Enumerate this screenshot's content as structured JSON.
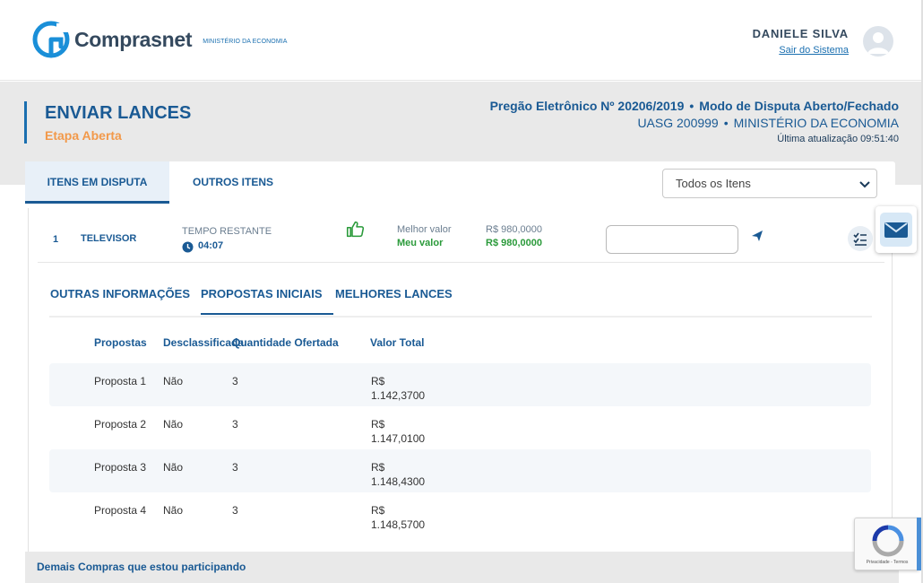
{
  "header": {
    "brand": "Comprasnet",
    "ministry": "MINISTÉRIO DA ECONOMIA",
    "user_name": "DANIELE SILVA",
    "logout": "Sair do Sistema"
  },
  "page": {
    "title": "ENVIAR LANCES",
    "subtitle": "Etapa Aberta",
    "pregao": "Pregão Eletrônico Nº 20206/2019",
    "dot": "•",
    "mode": "Modo de Disputa Aberto/Fechado",
    "uasg": "UASG 200999",
    "ministry": "MINISTÉRIO DA ECONOMIA",
    "last_update": "Última atualização 09:51:40"
  },
  "tabs": [
    {
      "label": "ITENS EM DISPUTA"
    },
    {
      "label": "OUTROS ITENS"
    }
  ],
  "filter": {
    "selected": "Todos os Itens"
  },
  "item": {
    "number": "1",
    "name": "TELEVISOR",
    "tempo_label": "TEMPO RESTANTE",
    "tempo_value": "04:07",
    "best_label": "Melhor valor",
    "my_label": "Meu valor",
    "best_value": "R$ 980,0000",
    "my_value": "R$ 980,0000"
  },
  "subtabs": [
    {
      "label": "OUTRAS INFORMAÇÕES"
    },
    {
      "label": "PROPOSTAS INICIAIS"
    },
    {
      "label": "MELHORES LANCES"
    }
  ],
  "table": {
    "headers": [
      "Propostas",
      "Desclassificada",
      "Quantidade Ofertada",
      "Valor Total"
    ],
    "rows": [
      {
        "proposta": "Proposta 1",
        "desclassificada": "Não",
        "quantidade": "3",
        "currency": "R$",
        "valor": "1.142,3700"
      },
      {
        "proposta": "Proposta 2",
        "desclassificada": "Não",
        "quantidade": "3",
        "currency": "R$",
        "valor": "1.147,0100"
      },
      {
        "proposta": "Proposta 3",
        "desclassificada": "Não",
        "quantidade": "3",
        "currency": "R$",
        "valor": "1.148,4300"
      },
      {
        "proposta": "Proposta 4",
        "desclassificada": "Não",
        "quantidade": "3",
        "currency": "R$",
        "valor": "1.148,5700"
      }
    ]
  },
  "footer": {
    "label": "Demais Compras que estou participando"
  },
  "recaptcha": {
    "text": "Privacidade - Termos"
  },
  "icons": {
    "logo": "comprasnet-logo-icon",
    "avatar": "user-avatar-icon",
    "clock": "clock-icon",
    "thumbs_up": "thumbs-up-icon",
    "send": "send-icon",
    "checklist": "checklist-icon",
    "mail": "mail-icon",
    "chevron": "chevron-down-icon",
    "recaptcha": "recaptcha-icon"
  },
  "colors": {
    "primary": "#1a5a94",
    "accent_orange": "#f2994a",
    "green": "#2a9a3a",
    "band_gray": "#e9e9e9"
  }
}
